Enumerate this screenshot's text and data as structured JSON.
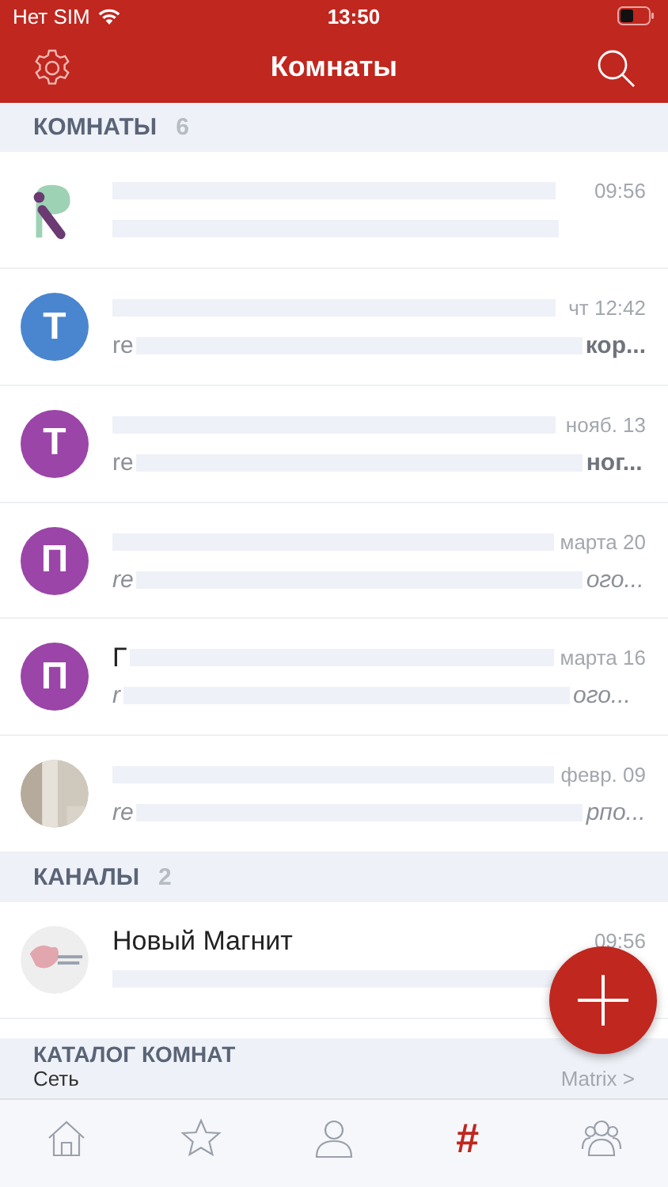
{
  "status_bar": {
    "carrier": "Нет SIM",
    "time": "13:50"
  },
  "nav": {
    "title": "Комнаты"
  },
  "sections": [
    {
      "title": "КОМНАТЫ",
      "count": "6",
      "rows": [
        {
          "avatar": {
            "kind": "logo"
          },
          "time": "09:56"
        },
        {
          "avatar": {
            "kind": "letter",
            "letter": "Т",
            "color": "#4a86cf"
          },
          "time": "чт 12:42",
          "preview_start": "re",
          "preview_end": "кор...",
          "italic": false,
          "unread": true
        },
        {
          "avatar": {
            "kind": "letter",
            "letter": "Т",
            "color": "#9b45a8"
          },
          "time": "нояб. 13",
          "preview_start": "re",
          "preview_end": "ног...",
          "italic": false,
          "unread": true
        },
        {
          "avatar": {
            "kind": "letter",
            "letter": "П",
            "color": "#9b45a8"
          },
          "time": "марта 20",
          "preview_start": "re",
          "preview_end": "ого...",
          "italic": true,
          "unread": false
        },
        {
          "avatar": {
            "kind": "letter",
            "letter": "П",
            "color": "#9b45a8"
          },
          "name": "Г",
          "time": "марта 16",
          "preview_start": "r",
          "preview_end": "ого...",
          "italic": true,
          "unread": false
        },
        {
          "time": "февр. 09",
          "preview_start": "re",
          "preview_end": "рпо...",
          "italic": true,
          "unread": false
        }
      ]
    },
    {
      "title": "КАНАЛЫ",
      "count": "2",
      "rows": [
        {
          "name": "Новый Магнит",
          "time": "09:56"
        }
      ]
    }
  ],
  "catalog": {
    "title": "КАТАЛОГ КОМНАТ",
    "network_label": "Сеть",
    "network_value": "Matrix",
    "chevron": ">"
  },
  "tabs": [
    {
      "selected": false
    },
    {
      "selected": false
    },
    {
      "selected": false
    },
    {
      "glyph": "#",
      "selected": true
    },
    {
      "selected": false
    }
  ]
}
